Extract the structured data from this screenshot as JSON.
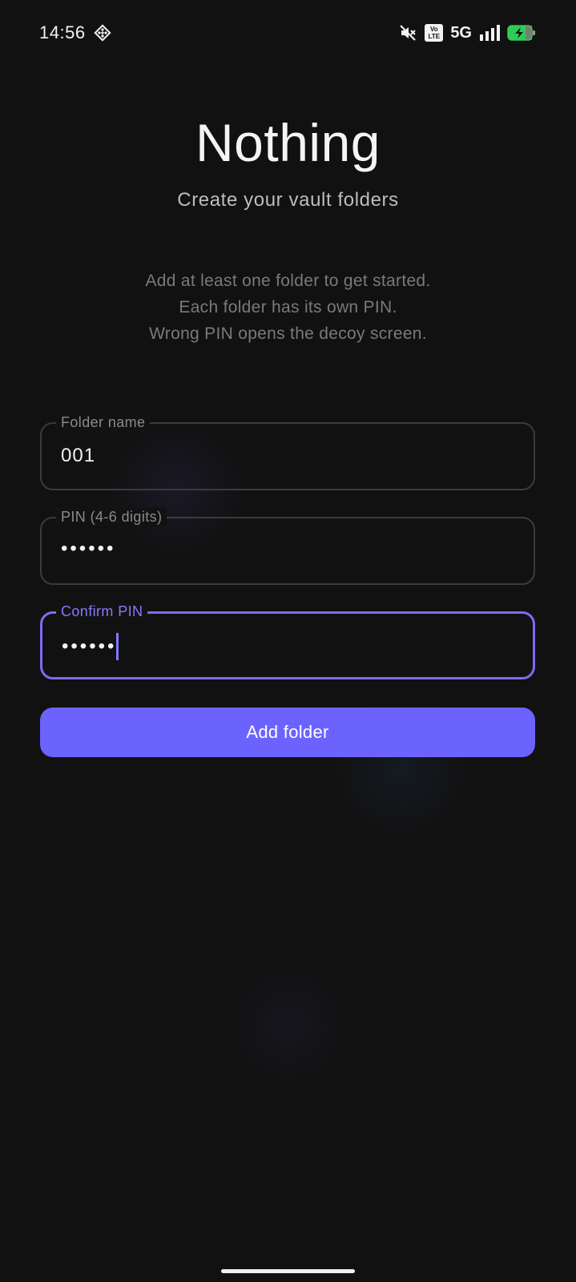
{
  "status_bar": {
    "time": "14:56",
    "app_icon": "diamond-grid-icon",
    "mute_icon": "mute-icon",
    "volte": {
      "line1": "Vo",
      "line2": "LTE"
    },
    "network": "5G",
    "signal_icon": "signal-bars-icon",
    "battery_icon": "battery-charging-icon"
  },
  "header": {
    "title": "Nothing",
    "subtitle": "Create your vault folders"
  },
  "help": {
    "line1": "Add at least one folder to get started.",
    "line2": "Each folder has its own PIN.",
    "line3": "Wrong PIN opens the decoy screen."
  },
  "form": {
    "folder_name": {
      "label": "Folder name",
      "value": "001"
    },
    "pin": {
      "label": "PIN (4-6 digits)",
      "masked_value": "••••••"
    },
    "confirm_pin": {
      "label": "Confirm PIN",
      "masked_value": "••••••"
    }
  },
  "actions": {
    "add_folder_label": "Add folder"
  },
  "colors": {
    "background": "#111111",
    "accent": "#6c63ff",
    "accent_label": "#8578ff",
    "battery_green": "#2ecc55"
  }
}
